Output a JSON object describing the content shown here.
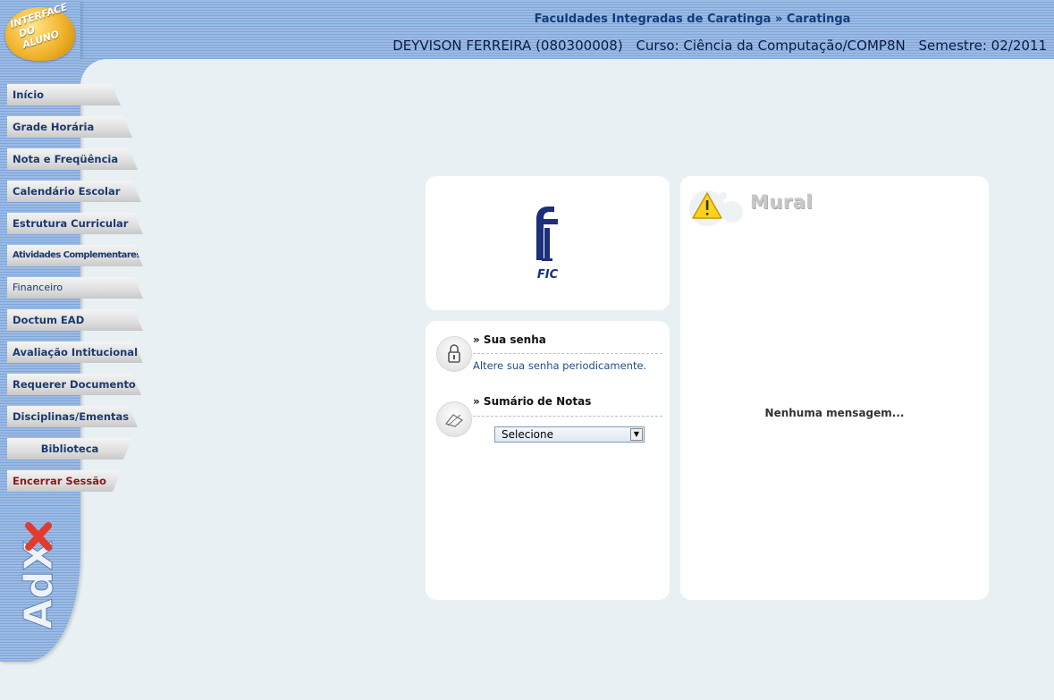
{
  "header": {
    "institution": "Faculdades Integradas de Caratinga » Caratinga",
    "student": "DEYVISON FERREIRA (080300008)",
    "course": "Curso: Ciência da Computação/COMP8N",
    "semester": "Semestre: 02/2011"
  },
  "badge": {
    "line1": "INTERFACE",
    "line2": "DO ALUNO"
  },
  "menu": {
    "items": [
      {
        "label": "Início"
      },
      {
        "label": "Grade Horária"
      },
      {
        "label": "Nota e Freqüência"
      },
      {
        "label": "Calendário Escolar"
      },
      {
        "label": "Estrutura Curricular"
      },
      {
        "label": "Atividades Complementares"
      },
      {
        "label": "Financeiro"
      },
      {
        "label": "Doctum EAD"
      },
      {
        "label": "Avaliação Intitucional"
      },
      {
        "label": "Requerer Documento"
      },
      {
        "label": "Disciplinas/Ementas"
      },
      {
        "label": "Biblioteca"
      },
      {
        "label": "Encerrar Sessão"
      }
    ]
  },
  "sidebar_logo": {
    "text": "AdX"
  },
  "fic_panel": {
    "logo_text": "FIC"
  },
  "links_panel": {
    "password": {
      "title": "» Sua senha",
      "link": "Altere sua senha periodicamente."
    },
    "grades": {
      "title": "» Sumário de Notas",
      "select_value": "Selecione"
    }
  },
  "mural": {
    "title": "Mural",
    "empty_message": "Nenhuma mensagem..."
  },
  "colors": {
    "header_blue": "#9bbbe5",
    "title_blue": "#123c7a",
    "logout_red": "#8a1a1a",
    "badge_gold": "#f2b32c"
  },
  "icons": [
    "lock-icon",
    "notes-icon",
    "warning-icon",
    "select-arrow-icon"
  ]
}
